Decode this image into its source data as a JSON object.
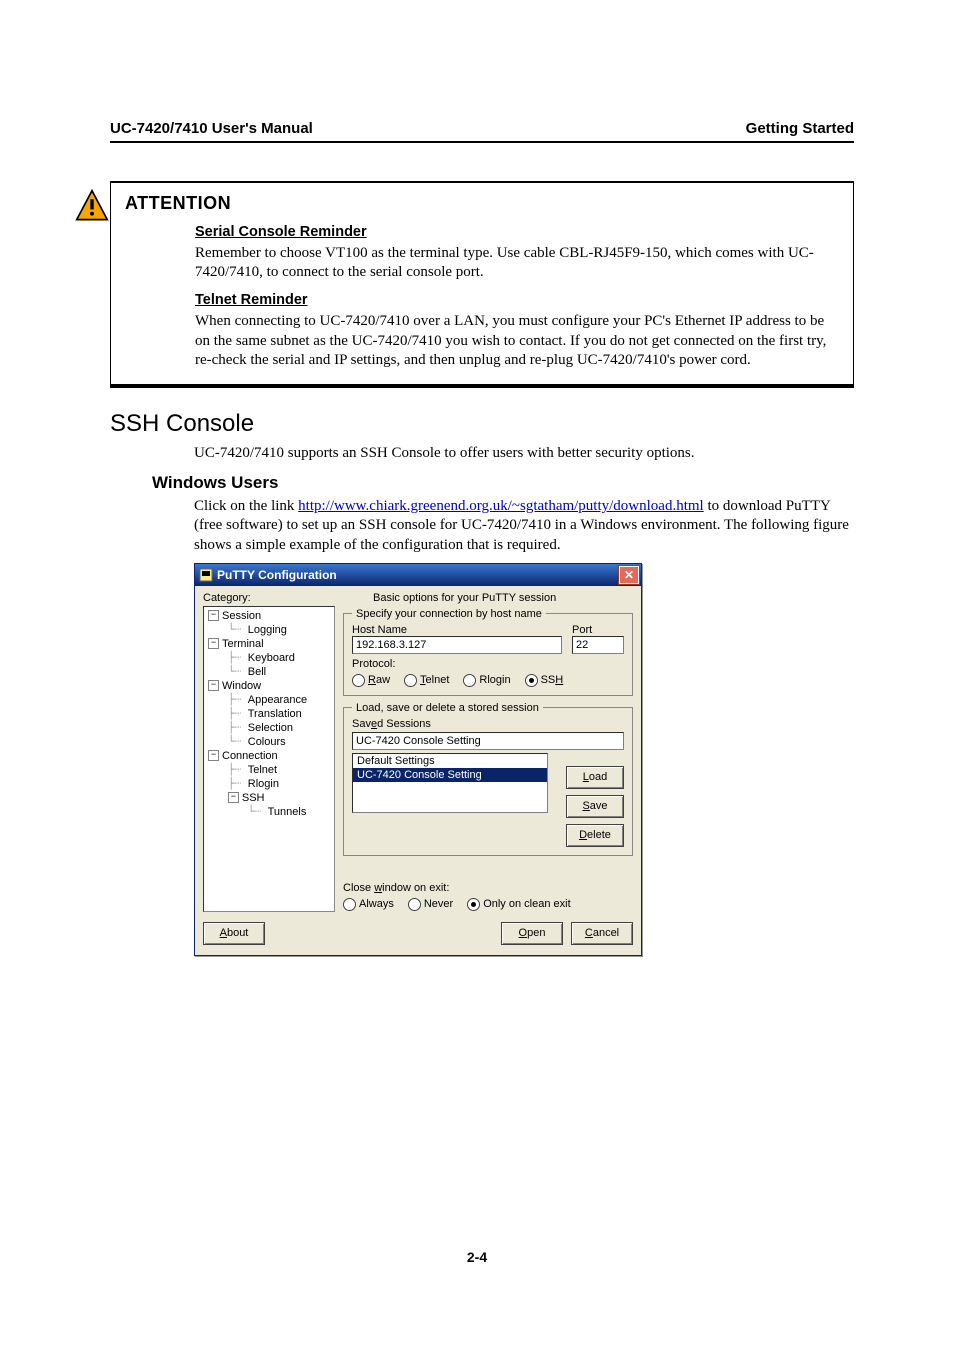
{
  "header": {
    "left": "UC-7420/7410 User's Manual",
    "right": "Getting Started"
  },
  "attention": {
    "title": "ATTENTION",
    "sub1": "Serial Console Reminder",
    "para1": "Remember to choose VT100 as the terminal type. Use cable CBL-RJ45F9-150, which comes with UC-7420/7410, to connect to the serial console port.",
    "sub2": "Telnet Reminder",
    "para2": "When connecting to UC-7420/7410 over a LAN, you must configure your PC's Ethernet IP address to be on the same subnet as the UC-7420/7410 you wish to contact. If you do not get connected on the first try, re-check the serial and IP settings, and then unplug and re-plug UC-7420/7410's power cord."
  },
  "section": {
    "h2": "SSH Console",
    "intro": "UC-7420/7410 supports an SSH Console to offer users with better security options.",
    "h3": "Windows Users",
    "click_prefix": "Click on the link ",
    "link_text": "http://www.chiark.greenend.org.uk/~sgtatham/putty/download.html",
    "click_suffix": " to download PuTTY (free software) to set up an SSH console for UC-7420/7410 in a Windows environment. The following figure shows a simple example of the configuration that is required."
  },
  "putty": {
    "title": "PuTTY Configuration",
    "category_label": "Category:",
    "tree": {
      "session": "Session",
      "logging": "Logging",
      "terminal": "Terminal",
      "keyboard": "Keyboard",
      "bell": "Bell",
      "window": "Window",
      "appearance": "Appearance",
      "translation": "Translation",
      "selection": "Selection",
      "colours": "Colours",
      "connection": "Connection",
      "telnet": "Telnet",
      "rlogin": "Rlogin",
      "ssh": "SSH",
      "tunnels": "Tunnels"
    },
    "panel": {
      "title": "Basic options for your PuTTY session",
      "group1_legend": "Specify your connection by host name",
      "hostname_label": "Host Name",
      "hostname_value": "192.168.3.127",
      "port_label": "Port",
      "port_value": "22",
      "protocol_label": "Protocol:",
      "protocols": {
        "raw": "Raw",
        "telnet": "Telnet",
        "rlogin": "Rlogin",
        "ssh": "SSH"
      },
      "protocol_selected": "ssh",
      "group2_legend": "Load, save or delete a stored session",
      "saved_label": "Saved Sessions",
      "saved_value": "UC-7420 Console Setting",
      "list_default": "Default Settings",
      "list_selected": "UC-7420 Console Setting",
      "load": "Load",
      "save": "Save",
      "delete": "Delete",
      "close_label": "Close window on exit:",
      "close_opts": {
        "always": "Always",
        "never": "Never",
        "clean": "Only on clean exit"
      },
      "close_selected": "clean"
    },
    "about": "About",
    "open": "Open",
    "cancel": "Cancel"
  },
  "page_number": "2-4"
}
